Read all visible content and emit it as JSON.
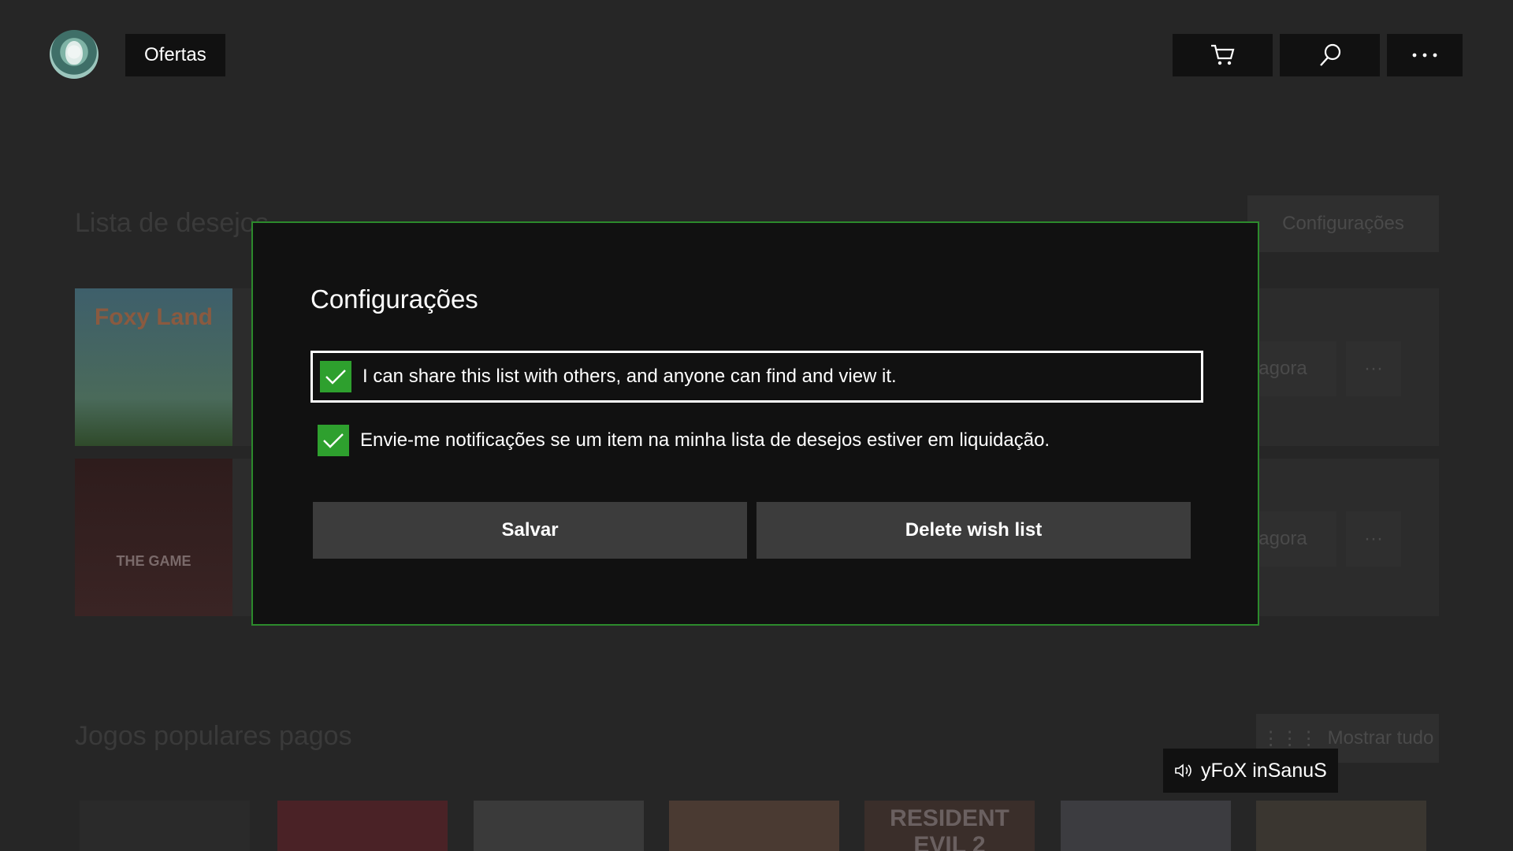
{
  "header": {
    "nav_label": "Ofertas",
    "buttons": {
      "cart_icon": "cart-icon",
      "search_icon": "search-icon",
      "more_icon": "more-icon"
    }
  },
  "background": {
    "wishlist_title": "Lista de desejos",
    "settings_button": "Configurações",
    "buy_button_partial": "agora",
    "popular_title": "Jogos populares pagos",
    "show_all_button": "Mostrar tudo",
    "wishlist_items": [
      {
        "thumb_text": "Foxy Land"
      },
      {
        "thumb_text": "THE GAME"
      }
    ],
    "popular_items": [
      {
        "thumb_text": ""
      },
      {
        "thumb_text": ""
      },
      {
        "thumb_text": ""
      },
      {
        "thumb_text": ""
      },
      {
        "thumb_text": "RESIDENT EVIL 2"
      },
      {
        "thumb_text": ""
      },
      {
        "thumb_text": ""
      }
    ]
  },
  "dialog": {
    "title": "Configurações",
    "options": [
      {
        "label": "I can share this list with others, and anyone can find and view it.",
        "checked": true
      },
      {
        "label": "Envie-me notificações se um item na minha lista de desejos estiver em liquidação.",
        "checked": true
      }
    ],
    "save_label": "Salvar",
    "delete_label": "Delete wish list"
  },
  "toast": {
    "gamertag": "yFoX inSanuS",
    "icon": "speaker-icon"
  },
  "colors": {
    "accent_green": "#2ea02e",
    "dialog_border": "#2c8a2c",
    "background": "#262626"
  }
}
